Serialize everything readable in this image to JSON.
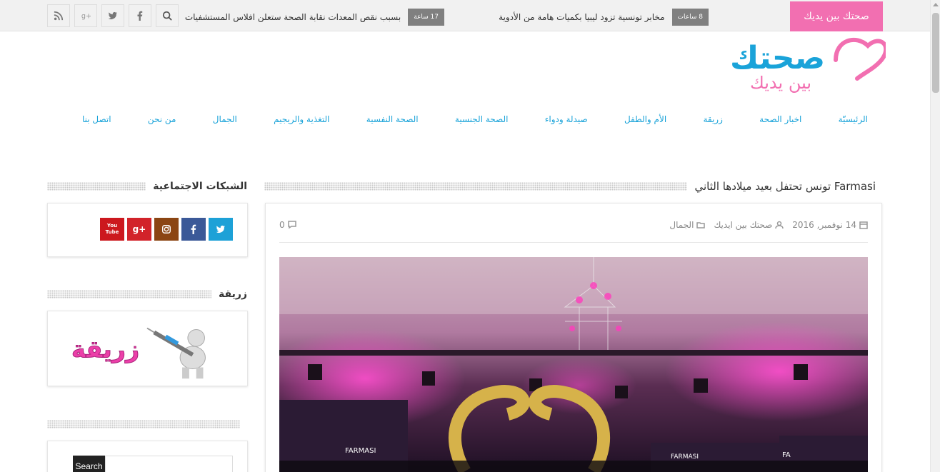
{
  "topbar": {
    "brand_label": "صحتك بين يديك",
    "ticker": [
      {
        "badge": "8 ساعات",
        "text": "مخابر تونسية تزود ليبيا بكميات هامة من الأدوية"
      },
      {
        "badge": "17 ساعة",
        "text": "بسبب نقص المعدات نقابة الصحة ستعلن افلاس المستشفيات"
      }
    ],
    "social_icons": [
      "search-icon",
      "facebook-icon",
      "twitter-icon",
      "google-plus-icon",
      "rss-icon"
    ]
  },
  "logo": {
    "main": "صحتك",
    "sub": "بين يديك",
    "colors": {
      "blue": "#1aa3d9",
      "pink": "#f26fb1"
    }
  },
  "nav": {
    "items": [
      "الرئيسيّة",
      "اخبار الصحة",
      "زريقة",
      "الأم والطفل",
      "صيدلة ودواء",
      "الصحة الجنسية",
      "الصحة النفسية",
      "التغذية والريجيم",
      "الجمال",
      "من نحن",
      "اتصل بنا"
    ]
  },
  "article": {
    "title": "Farmasi تونس تحتفل بعيد ميلادها الثاني",
    "date": "14 نوفمبر, 2016",
    "author": "صحتك بين ايديك",
    "category": "الجمال",
    "comments": "0",
    "image_labels": [
      "FARMASI",
      "FARMASI",
      "FA"
    ]
  },
  "sidebar": {
    "social_title": "الشبكات الاجتماعية",
    "social_buttons": [
      {
        "name": "twitter",
        "color": "#1da1d7"
      },
      {
        "name": "facebook",
        "color": "#3b5998"
      },
      {
        "name": "instagram",
        "color": "#8b4513"
      },
      {
        "name": "google-plus",
        "color": "#d2232a"
      },
      {
        "name": "youtube",
        "color": "#cc181e",
        "label": "You Tube"
      }
    ],
    "zriga_title": "زريقة",
    "zriga_banner_text": "زريقة",
    "search_button": "Search",
    "search_placeholder": ""
  }
}
